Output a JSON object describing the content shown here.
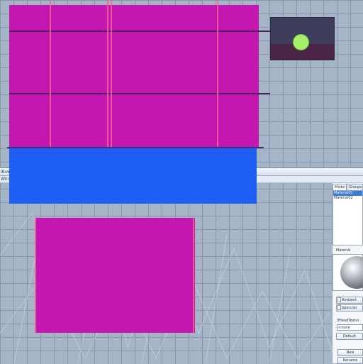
{
  "window": {
    "title": "lKvw",
    "menu": "Win"
  },
  "material_panel": {
    "tabs": [
      {
        "label": "Model",
        "active": true
      },
      {
        "label": "Groups",
        "active": false
      }
    ],
    "materials": [
      {
        "label": "Material01",
        "selected": true
      },
      {
        "label": "Material02",
        "selected": false
      }
    ],
    "preview_label": "Material",
    "ambient_label": "Ambient",
    "specular_label": "Specular",
    "texture_label": "3HeadTextur",
    "texture_value": "<none",
    "default_button": "Default",
    "new_button": "New",
    "rename_button": "Rename"
  },
  "canvas": {
    "colors": {
      "magenta": "#c516b2",
      "blue": "#1e5ef4",
      "grid_background": "#a6b4c8",
      "thumbnail_background": "#3e3d5c",
      "thumbnail_dot": "#a6f06a"
    }
  }
}
